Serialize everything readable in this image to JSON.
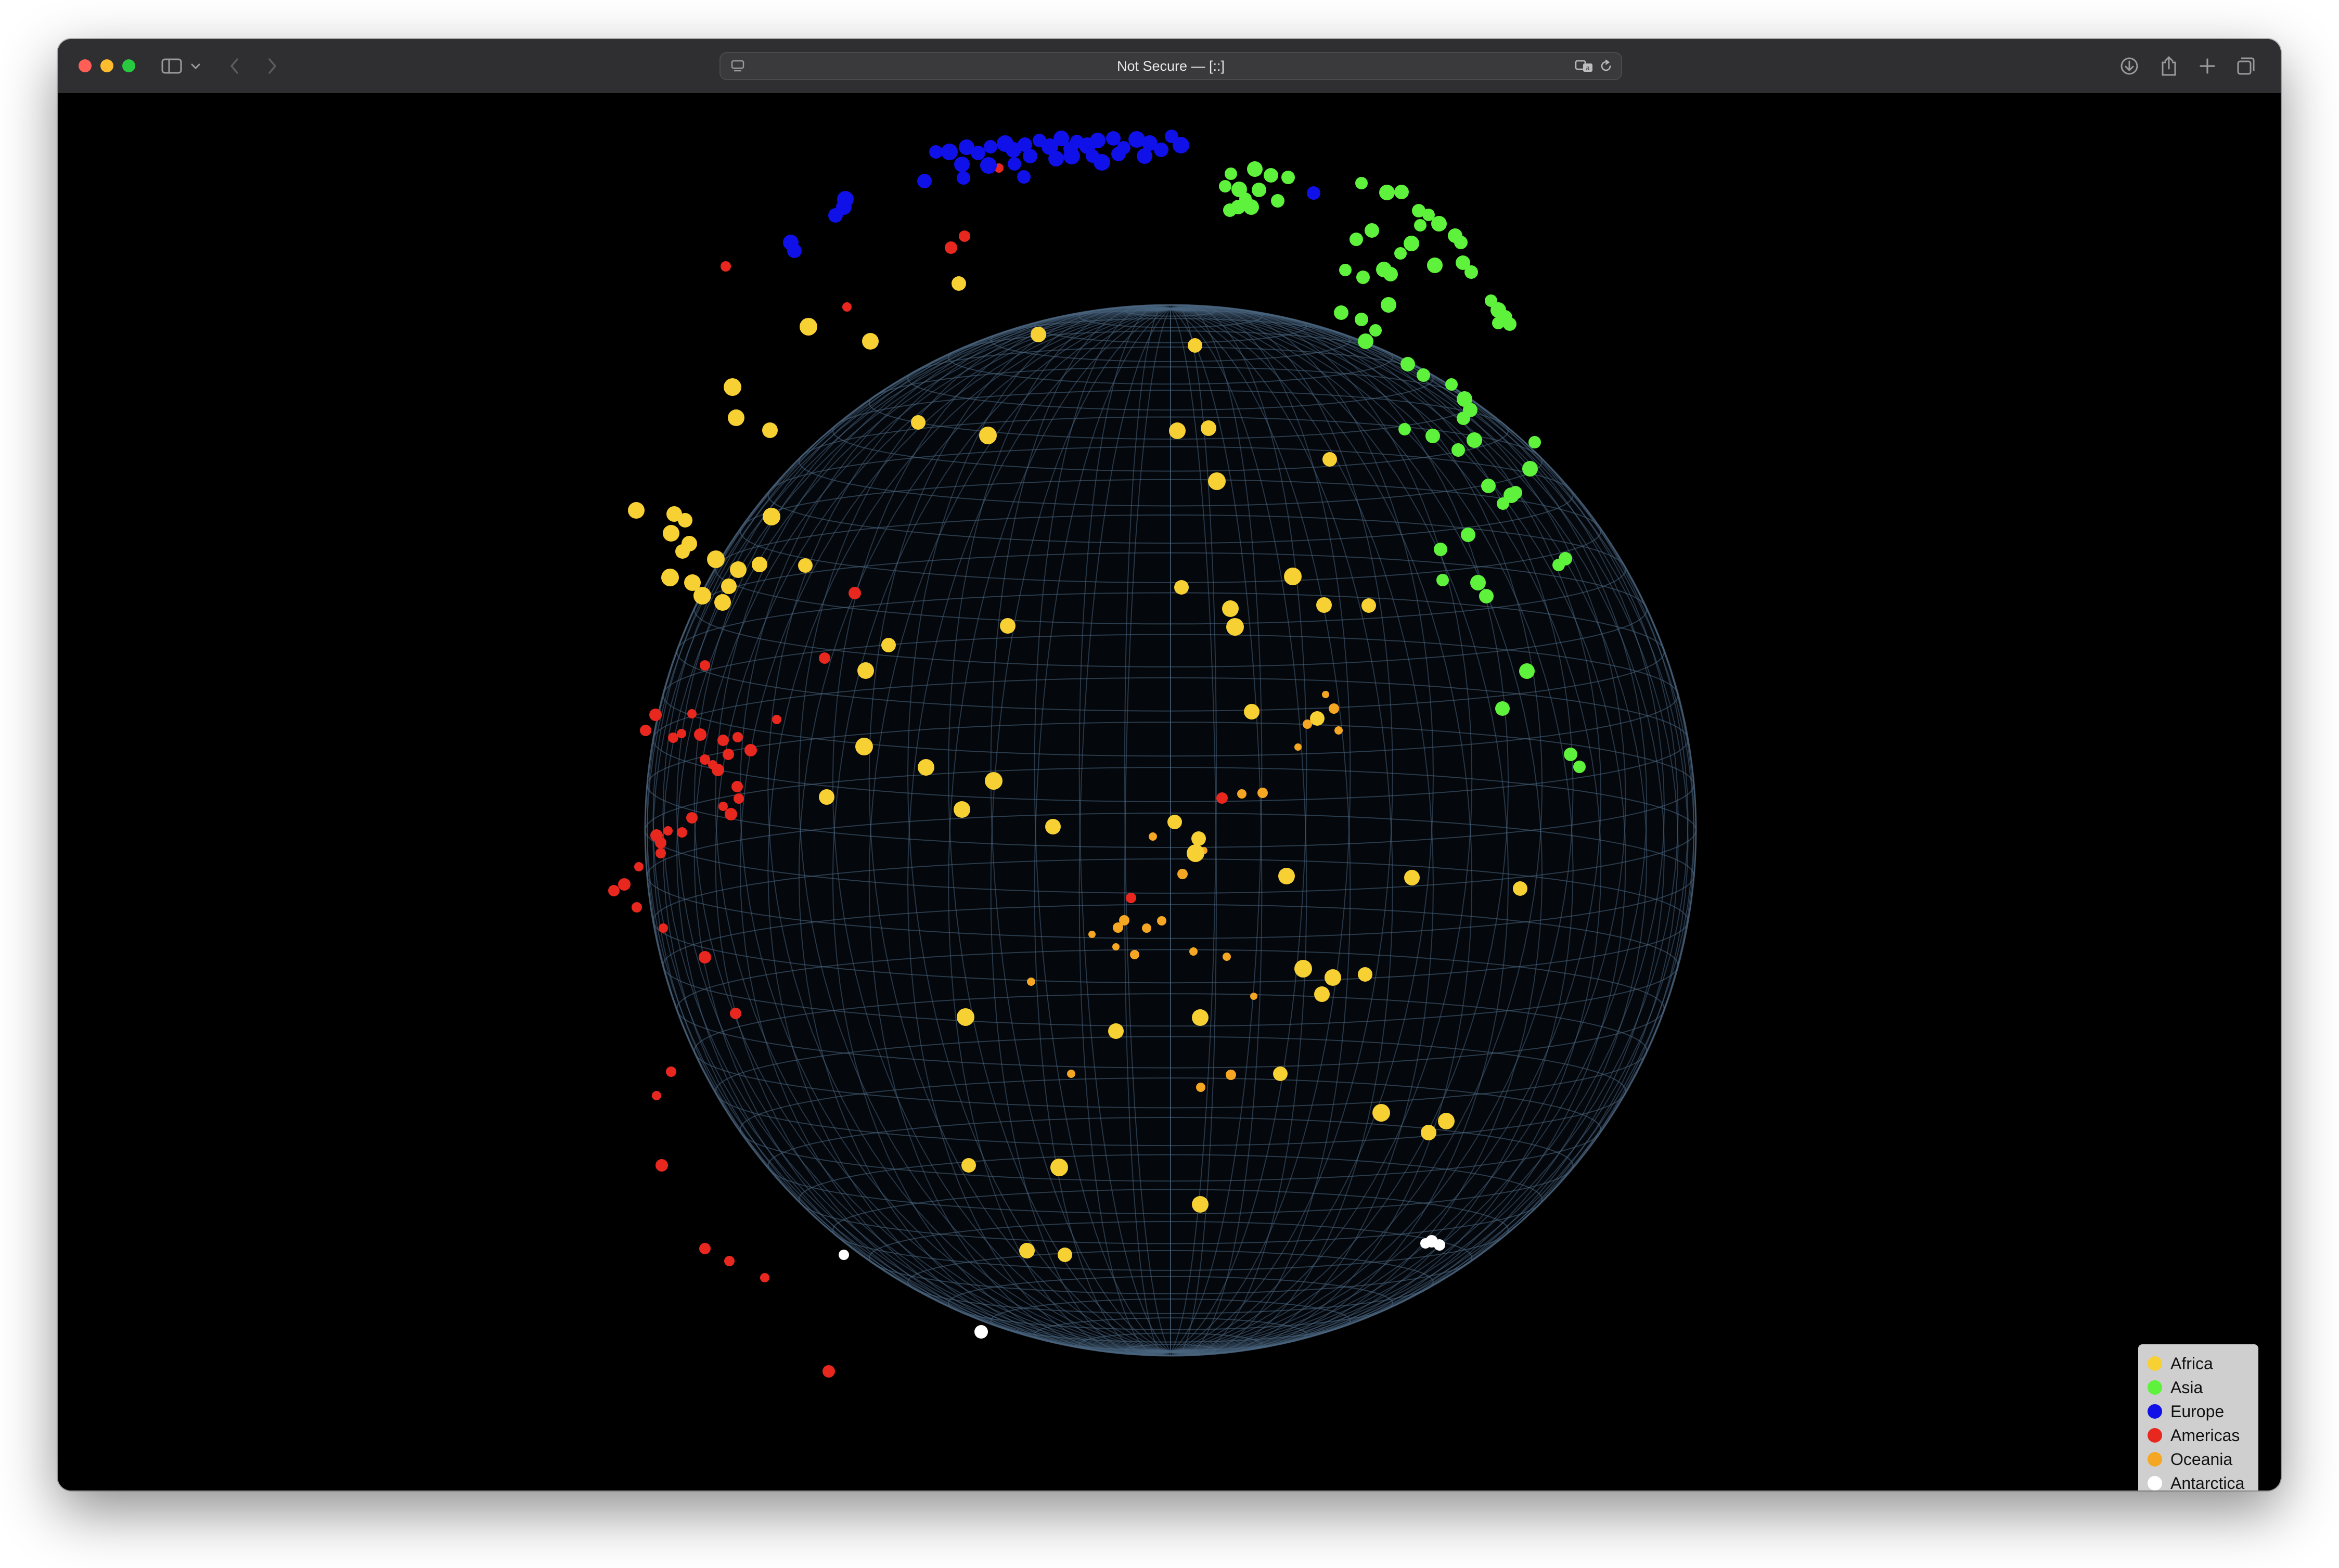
{
  "browser": {
    "address": "Not Secure — [::]"
  },
  "legend": {
    "items": [
      {
        "label": "Africa",
        "color": "#f7d033"
      },
      {
        "label": "Asia",
        "color": "#5ef23c"
      },
      {
        "label": "Europe",
        "color": "#1010e8"
      },
      {
        "label": "Americas",
        "color": "#e8271f"
      },
      {
        "label": "Oceania",
        "color": "#f5a623"
      },
      {
        "label": "Antarctica",
        "color": "#ffffff"
      }
    ]
  },
  "chart_data": {
    "type": "scatter",
    "series": [
      {
        "name": "Africa",
        "color": "#f7d033"
      },
      {
        "name": "Asia",
        "color": "#5ef23c"
      },
      {
        "name": "Europe",
        "color": "#1010e8"
      },
      {
        "name": "Americas",
        "color": "#e8271f"
      },
      {
        "name": "Oceania",
        "color": "#f5a623"
      },
      {
        "name": "Antarctica",
        "color": "#ffffff"
      }
    ],
    "grid": true,
    "legend_position": "bottom-right"
  }
}
